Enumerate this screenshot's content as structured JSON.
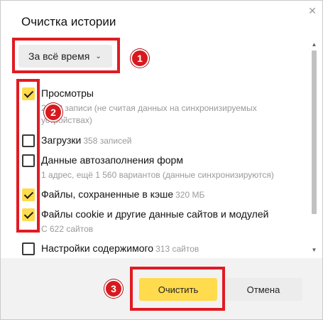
{
  "dialog": {
    "title": "Очистка истории",
    "close_glyph": "✕"
  },
  "period_select": {
    "value": "За всё время",
    "chevron": "⌄"
  },
  "items": [
    {
      "label": "Просмотры",
      "count": "",
      "detail": "2 238 записи (не считая данных на синхронизируемых устройствах)",
      "checked": true
    },
    {
      "label": "Загрузки",
      "count": "358 записей",
      "detail": "",
      "checked": false
    },
    {
      "label": "Данные автозаполнения форм",
      "count": "",
      "detail": "1 адрес, ещё 1 560 вариантов (данные синхронизируются)",
      "checked": false
    },
    {
      "label": "Файлы, сохраненные в кэше",
      "count": "320 МБ",
      "detail": "",
      "checked": true
    },
    {
      "label": "Файлы cookie и другие данные сайтов и модулей",
      "count": "",
      "detail": "С 622 сайтов",
      "checked": true
    },
    {
      "label": "Настройки содержимого",
      "count": "313 сайтов",
      "detail": "",
      "checked": false
    }
  ],
  "buttons": {
    "clear": "Очистить",
    "cancel": "Отмена"
  },
  "annotations": [
    "1",
    "2",
    "3"
  ],
  "colors": {
    "accent_yellow": "#ffdb4d",
    "annotation_red": "#e11b22"
  }
}
